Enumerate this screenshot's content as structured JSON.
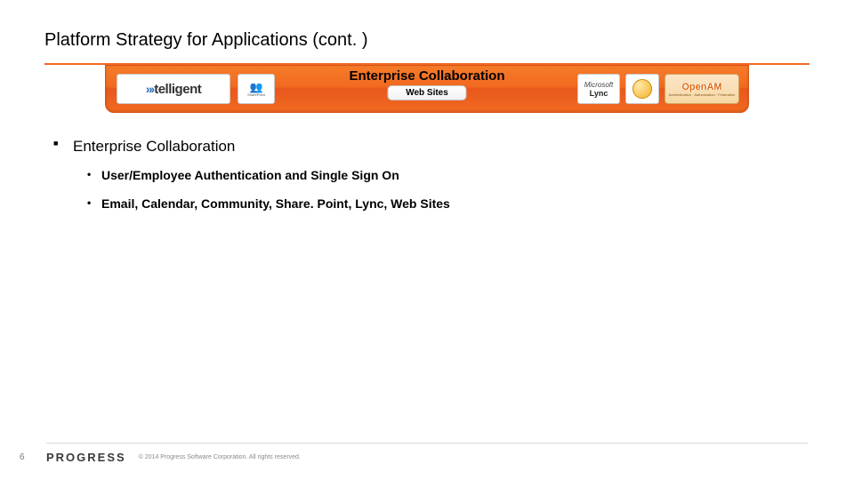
{
  "title": "Platform Strategy for Applications (cont. )",
  "banner": {
    "heading": "Enterprise Collaboration",
    "chip": "Web Sites",
    "logos": {
      "telligent": "telligent",
      "sharepoint": "SharePoint",
      "lync_brand": "Microsoft",
      "lync": "Lync",
      "openam": "OpenAM",
      "openam_sub": "Authentication · Authorization · Federation"
    }
  },
  "content": {
    "heading": "Enterprise Collaboration",
    "bullets": [
      "User/Employee Authentication and Single Sign On",
      "Email, Calendar, Community, Share. Point, Lync, Web Sites"
    ]
  },
  "footer": {
    "page": "6",
    "logo": "PROGRESS",
    "copyright": "© 2014 Progress Software Corporation. All rights reserved."
  }
}
